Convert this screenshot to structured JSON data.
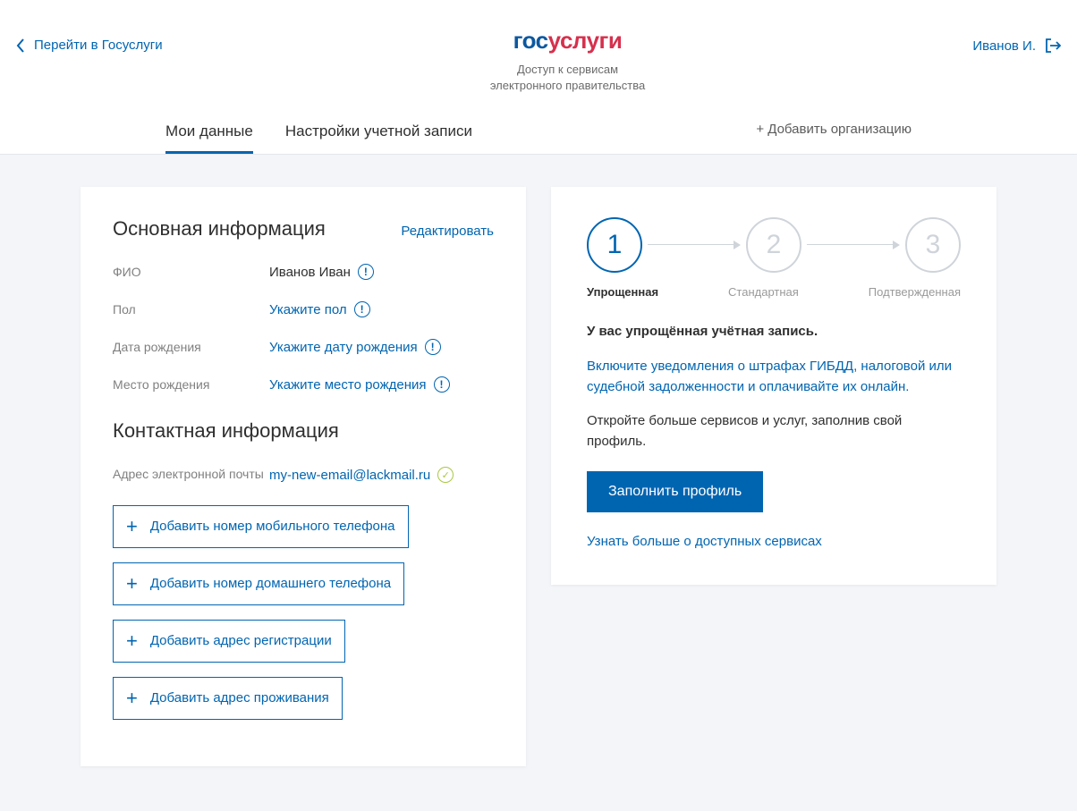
{
  "header": {
    "back": "Перейти в Госуслуги",
    "logo_gos": "гос",
    "logo_usl": "услуги",
    "subtitle": "Доступ к сервисам\nэлектронного правительства",
    "user": "Иванов И."
  },
  "tabs": {
    "my_data": "Мои данные",
    "settings": "Настройки учетной записи",
    "add_org": "+ Добавить организацию"
  },
  "basic": {
    "title": "Основная информация",
    "edit": "Редактировать",
    "fio_label": "ФИО",
    "fio_value": "Иванов Иван",
    "gender_label": "Пол",
    "gender_value": "Укажите пол",
    "dob_label": "Дата рождения",
    "dob_value": "Укажите дату рождения",
    "pob_label": "Место рождения",
    "pob_value": "Укажите место рождения"
  },
  "contact": {
    "title": "Контактная информация",
    "email_label": "Адрес электронной почты",
    "email_value": "my-new-email@lackmail.ru",
    "add_mobile": "Добавить номер мобильного телефона",
    "add_home": "Добавить номер домашнего телефона",
    "add_reg": "Добавить адрес регистрации",
    "add_live": "Добавить адрес проживания"
  },
  "status": {
    "step1": "1",
    "step2": "2",
    "step3": "3",
    "label1": "Упрощенная",
    "label2": "Стандартная",
    "label3": "Подтвержденная",
    "heading": "У вас упрощённая учётная запись.",
    "notify": "Включите уведомления о штрафах ГИБДД, налоговой или судебной задолженности и оплачивайте их онлайн.",
    "open_more": "Откройте больше сервисов и услуг, заполнив свой профиль.",
    "fill_btn": "Заполнить профиль",
    "more_link": "Узнать больше о доступных сервисах"
  }
}
